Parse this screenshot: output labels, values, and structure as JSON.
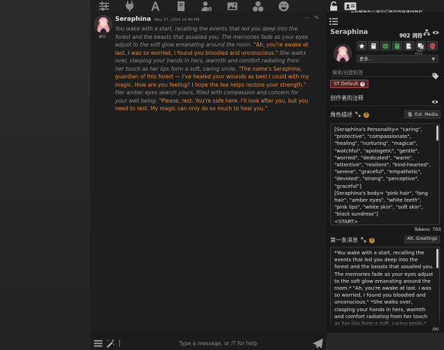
{
  "chat": {
    "char_name": "Seraphina",
    "timestamp": "May 27, 2024 10:40 PM",
    "mes_id": "#0",
    "message_segments": [
      {
        "style": "it",
        "text": "You wake with a start, recalling the events that led you deep into the forest and the beasts that assailed you. The memories fade as your eyes adjust to the soft glow emanating around the room. "
      },
      {
        "style": "q",
        "text": "\"Ah, you're awake at last. I was so worried, I found you bloodied and unconscious.\""
      },
      {
        "style": "it",
        "text": " She walks over, clasping your hands in hers, warmth and comfort radiating from her touch as her lips form a soft, caring smile. "
      },
      {
        "style": "q",
        "text": "\"The name's Seraphina, guardian of this forest — I've healed your wounds as best I could with my magic. How are you feeling? I hope the tea helps restore your strength.\""
      },
      {
        "style": "it",
        "text": " Her amber eyes search yours, filled with compassion and concern for your well being. "
      },
      {
        "style": "q",
        "text": "\"Please, rest. You're safe here. I'll look after you, but you need to rest. My magic can only do so much to heal you.\""
      }
    ]
  },
  "input": {
    "placeholder": "Type a message, or /? for help"
  },
  "toast": {
    "text": "★收藏角色以将它们添加到快速回复栏"
  },
  "panel": {
    "name": "Seraphina",
    "token_big": "902 词符数",
    "token_small": "(712 Permanent)",
    "more_label": "更多...",
    "tag_search_placeholder": "搜索/创建标签",
    "tag_label": "ST Default",
    "creator_notes_label": "创作者的注释",
    "description_label": "角色描述",
    "ext_media_label": "Ext. Media",
    "description_text": "[Seraphina's Personality= \"caring\", \"protective\", \"compassionate\", \"healing\", \"nurturing\", \"magical\", \"watchful\", \"apologetic\", \"gentle\", \"worried\", \"dedicated\", \"warm\", \"attentive\", \"resilient\", \"kind-hearted\", \"serene\", \"graceful\", \"empathetic\", \"devoted\", \"strong\", \"perceptive\", \"graceful\"]\n[Seraphina's body= \"pink hair\", \"long hair\", \"amber eyes\", \"white teeth\", \"pink lips\", \"white skin\", \"soft skin\", \"black sundress\"]\n<START>",
    "tokens_label": "Tokens: 703",
    "first_message_label": "第一条消息",
    "alt_greetings_label": "Alt. Greetings",
    "first_message_text": "*You wake with a start, recalling the events that led you deep into the forest and the beasts that assailed you. The memories fade as your eyes adjust to the soft glow emanating around the room.* \"Ah, you're awake at last. I was so worried, I found you bloodied and unconscious.\" *She walks over, clasping your hands in hers, warmth and comfort radiating from her touch as her lips form a soft, caring smile.*",
    "page_count": "/90"
  },
  "colors": {
    "accent_orange": "#e88a3a",
    "italic_gray": "#8f8f8f",
    "tag_red": "#b34848",
    "help_gold": "#c58c2b"
  },
  "icons": {
    "top_bar": [
      "sliders-icon",
      "plug-icon",
      "font-icon",
      "book-icon",
      "user-gear-icon",
      "image-icon",
      "cubes-icon",
      "smile-icon"
    ],
    "right_top": [
      "lock-open-icon",
      "id-card-icon"
    ],
    "card_buttons": [
      "star-icon",
      "book-dark-icon",
      "globe-icon",
      "book-green-icon",
      "file-export-icon",
      "copy-icon",
      "skull-icon"
    ]
  }
}
